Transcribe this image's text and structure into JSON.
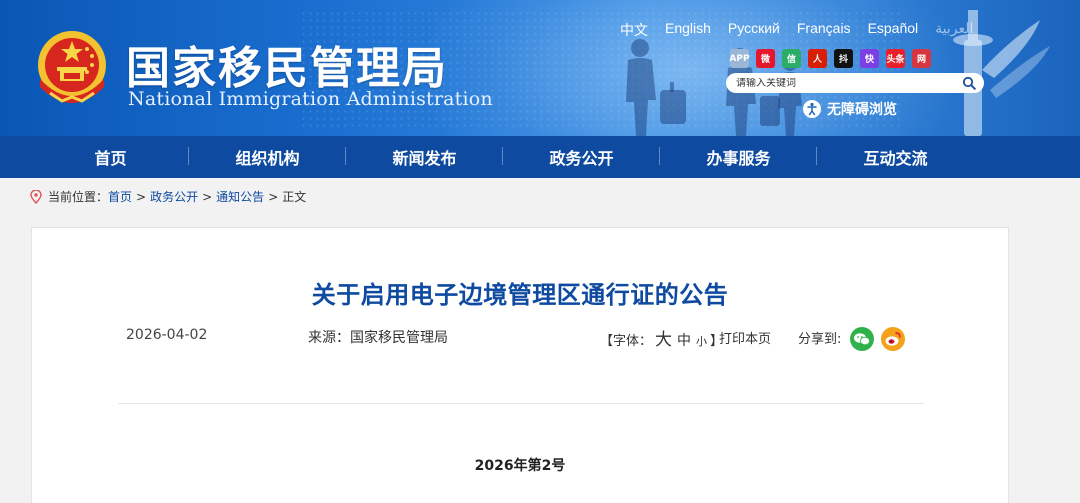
{
  "header": {
    "site_name_cn": "国家移民管理局",
    "site_name_en": "National Immigration Administration",
    "languages": [
      "中文",
      "English",
      "Русский",
      "Français",
      "Español",
      "العربية"
    ],
    "social_icons": [
      {
        "name": "app-icon",
        "label": "APP",
        "color": "#9bb6d6"
      },
      {
        "name": "weibo-icon",
        "label": "微",
        "color": "#e6162d"
      },
      {
        "name": "wechat-icon",
        "label": "信",
        "color": "#2aae67"
      },
      {
        "name": "people-daily-icon",
        "label": "人",
        "color": "#d81e06"
      },
      {
        "name": "douyin-icon",
        "label": "抖",
        "color": "#111111"
      },
      {
        "name": "kuaishou-icon",
        "label": "快",
        "color": "#7b3fe4"
      },
      {
        "name": "toutiao-icon",
        "label": "头条",
        "color": "#e8202b"
      },
      {
        "name": "bilibili-icon",
        "label": "网",
        "color": "#d6363f"
      }
    ],
    "search_placeholder": "请输入关键词",
    "accessibility_label": "无障碍浏览"
  },
  "nav": {
    "items": [
      "首页",
      "组织机构",
      "新闻发布",
      "政务公开",
      "办事服务",
      "互动交流"
    ]
  },
  "breadcrumb": {
    "label": "当前位置：",
    "items": [
      "首页",
      "政务公开",
      "通知公告"
    ],
    "current": "正文",
    "separator": ">"
  },
  "article": {
    "title": "关于启用电子边境管理区通行证的公告",
    "date": "2026-04-02",
    "source": "来源：国家移民管理局",
    "font_label_open": "【字体：",
    "font_large": "大",
    "font_medium": "中",
    "font_small": "小",
    "font_label_close": "】",
    "print_label": "打印本页",
    "share_label": "分享到:",
    "doc_number": "2026年第2号"
  },
  "colors": {
    "nav_bg": "#0d4aa0",
    "title": "#0d4aa0",
    "link": "#0d4aa0"
  }
}
